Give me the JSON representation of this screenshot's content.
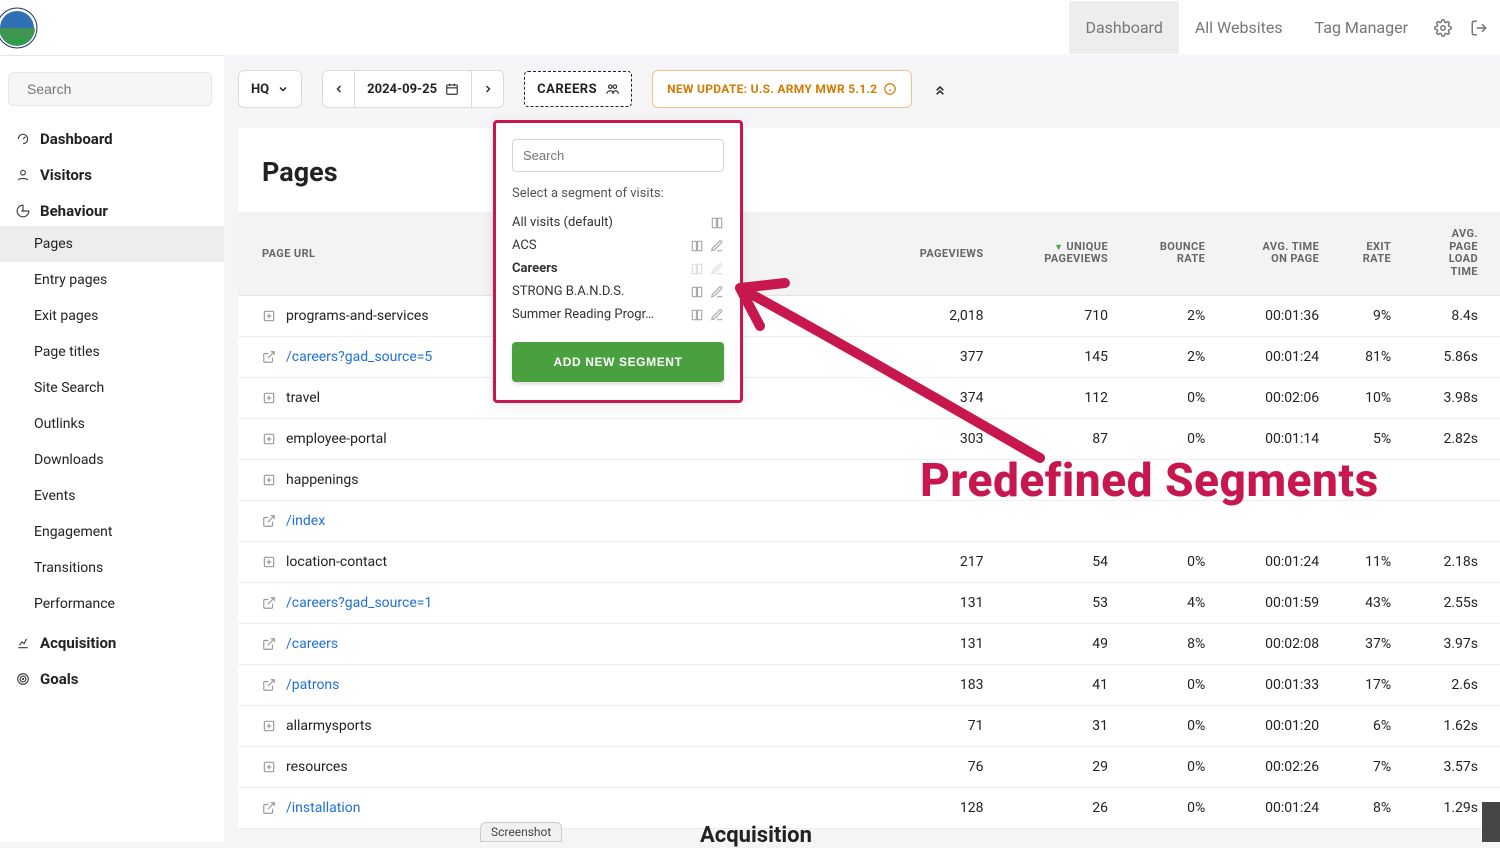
{
  "header": {
    "nav": {
      "dashboard": "Dashboard",
      "all_websites": "All Websites",
      "tag_manager": "Tag Manager"
    }
  },
  "sidebar": {
    "search_placeholder": "Search",
    "sections": {
      "dashboard": "Dashboard",
      "visitors": "Visitors",
      "behaviour": "Behaviour",
      "acquisition": "Acquisition",
      "goals": "Goals"
    },
    "behaviour_items": [
      "Pages",
      "Entry pages",
      "Exit pages",
      "Page titles",
      "Site Search",
      "Outlinks",
      "Downloads",
      "Events",
      "Engagement",
      "Transitions",
      "Performance"
    ]
  },
  "toolbar": {
    "site": "HQ",
    "date": "2024-09-25",
    "segment": "CAREERS",
    "update_text": "NEW UPDATE: U.S. ARMY MWR 5.1.2"
  },
  "page": {
    "title": "Pages"
  },
  "table": {
    "headers": {
      "page_url": "PAGE URL",
      "pageviews": "PAGEVIEWS",
      "unique_pageviews_1": "UNIQUE",
      "unique_pageviews_2": "PAGEVIEWS",
      "bounce_rate_1": "BOUNCE",
      "bounce_rate_2": "RATE",
      "avg_time_1": "AVG. TIME",
      "avg_time_2": "ON PAGE",
      "exit_rate_1": "EXIT",
      "exit_rate_2": "RATE",
      "load_time_1": "AVG.",
      "load_time_2": "PAGE",
      "load_time_3": "LOAD",
      "load_time_4": "TIME"
    },
    "rows": [
      {
        "type": "folder",
        "url": "programs-and-services",
        "pageviews": "2,018",
        "unique": "710",
        "bounce": "2%",
        "avg_time": "00:01:36",
        "exit": "9%",
        "load": "8.4s"
      },
      {
        "type": "link",
        "url": "/careers?gad_source=5",
        "pageviews": "377",
        "unique": "145",
        "bounce": "2%",
        "avg_time": "00:01:24",
        "exit": "81%",
        "load": "5.86s"
      },
      {
        "type": "folder",
        "url": "travel",
        "pageviews": "374",
        "unique": "112",
        "bounce": "0%",
        "avg_time": "00:02:06",
        "exit": "10%",
        "load": "3.98s"
      },
      {
        "type": "folder",
        "url": "employee-portal",
        "pageviews": "303",
        "unique": "87",
        "bounce": "0%",
        "avg_time": "00:01:14",
        "exit": "5%",
        "load": "2.82s"
      },
      {
        "type": "folder",
        "url": "happenings",
        "pageviews": "",
        "unique": "",
        "bounce": "",
        "avg_time": "",
        "exit": "",
        "load": ""
      },
      {
        "type": "link",
        "url": "/index",
        "pageviews": "",
        "unique": "",
        "bounce": "",
        "avg_time": "",
        "exit": "",
        "load": ""
      },
      {
        "type": "folder",
        "url": "location-contact",
        "pageviews": "217",
        "unique": "54",
        "bounce": "0%",
        "avg_time": "00:01:24",
        "exit": "11%",
        "load": "2.18s"
      },
      {
        "type": "link",
        "url": "/careers?gad_source=1",
        "pageviews": "131",
        "unique": "53",
        "bounce": "4%",
        "avg_time": "00:01:59",
        "exit": "43%",
        "load": "2.55s"
      },
      {
        "type": "link",
        "url": "/careers",
        "pageviews": "131",
        "unique": "49",
        "bounce": "8%",
        "avg_time": "00:02:08",
        "exit": "37%",
        "load": "3.97s"
      },
      {
        "type": "link",
        "url": "/patrons",
        "pageviews": "183",
        "unique": "41",
        "bounce": "0%",
        "avg_time": "00:01:33",
        "exit": "17%",
        "load": "2.6s"
      },
      {
        "type": "folder",
        "url": "allarmysports",
        "pageviews": "71",
        "unique": "31",
        "bounce": "0%",
        "avg_time": "00:01:20",
        "exit": "6%",
        "load": "1.62s"
      },
      {
        "type": "folder",
        "url": "resources",
        "pageviews": "76",
        "unique": "29",
        "bounce": "0%",
        "avg_time": "00:02:26",
        "exit": "7%",
        "load": "3.57s"
      },
      {
        "type": "link",
        "url": "/installation",
        "pageviews": "128",
        "unique": "26",
        "bounce": "0%",
        "avg_time": "00:01:24",
        "exit": "8%",
        "load": "1.29s"
      }
    ]
  },
  "segment_popover": {
    "search_placeholder": "Search",
    "label": "Select a segment of visits:",
    "items": [
      {
        "label": "All visits (default)",
        "bold": false,
        "has_edit": false
      },
      {
        "label": "ACS",
        "bold": false,
        "has_edit": true
      },
      {
        "label": "Careers",
        "bold": true,
        "has_edit": true
      },
      {
        "label": "STRONG B.A.N.D.S.",
        "bold": false,
        "has_edit": true
      },
      {
        "label": "Summer Reading Progr…",
        "bold": false,
        "has_edit": true
      }
    ],
    "add_button": "ADD NEW SEGMENT"
  },
  "annotation": {
    "label": "Predefined Segments"
  },
  "bottom": {
    "screenshot": "Screenshot",
    "acquisition": "Acquisition"
  }
}
